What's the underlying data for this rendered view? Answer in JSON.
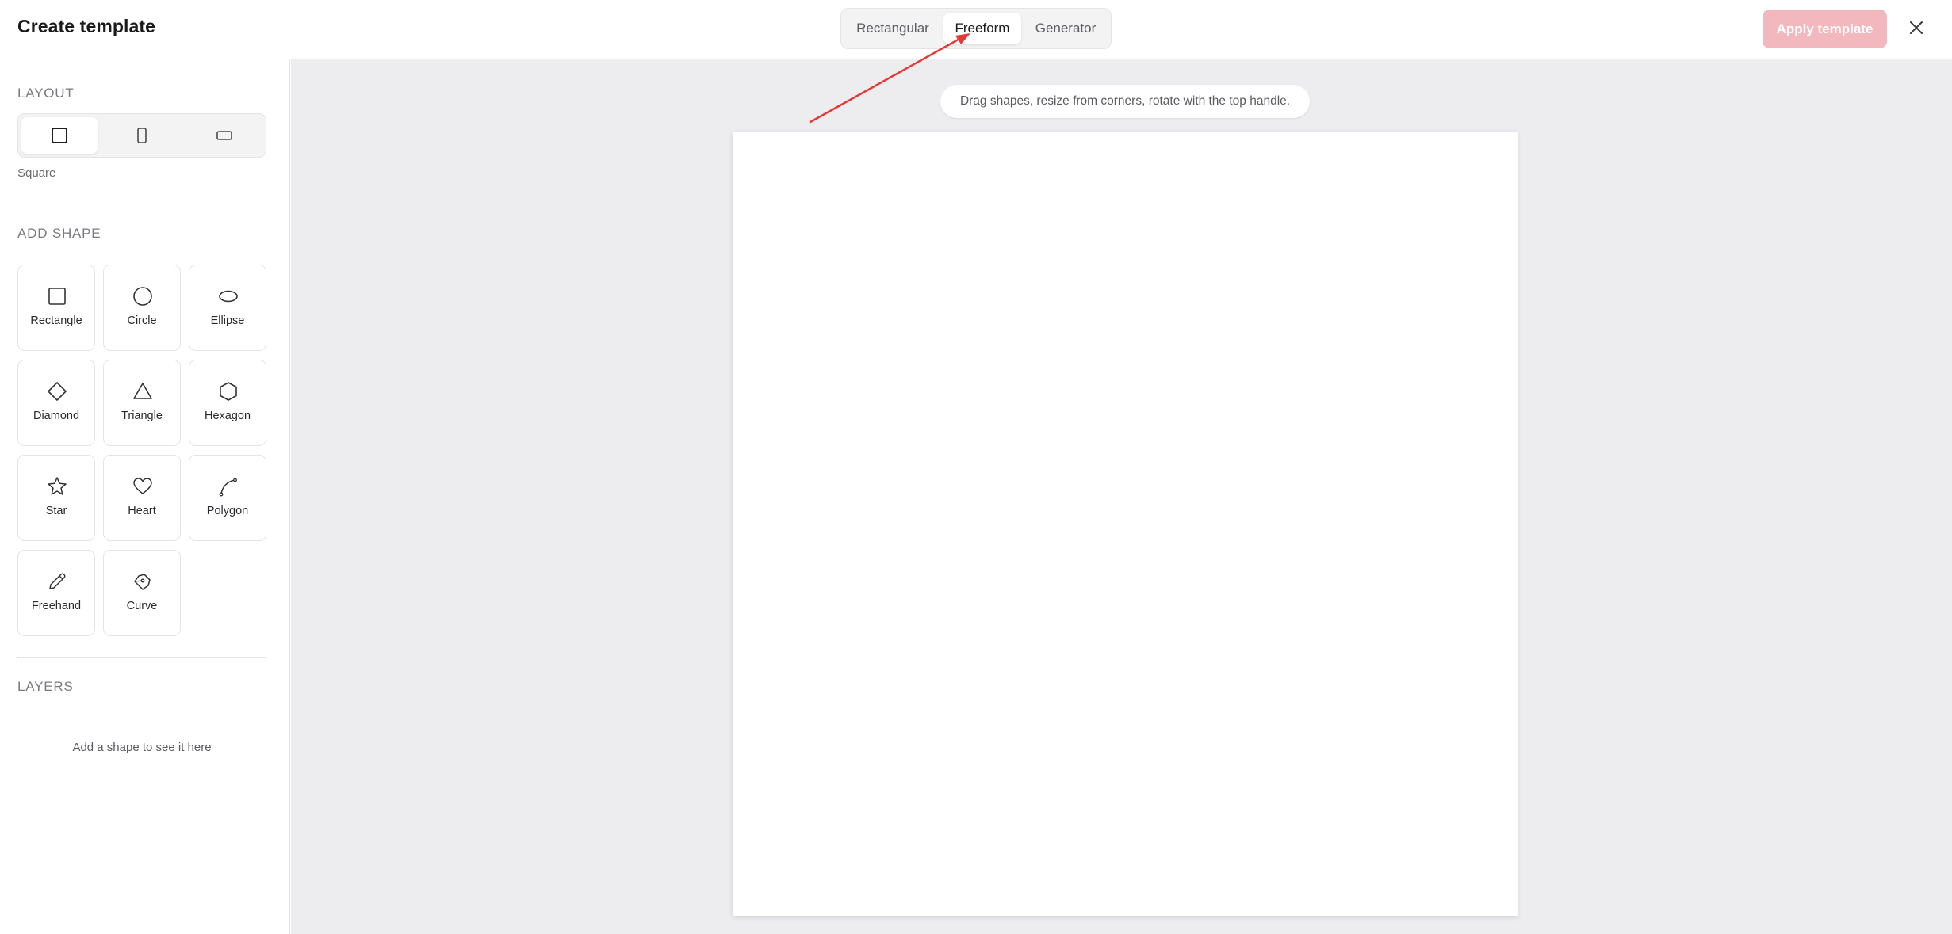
{
  "header": {
    "title": "Create template",
    "tabs": [
      {
        "label": "Rectangular",
        "active": false
      },
      {
        "label": "Freeform",
        "active": true
      },
      {
        "label": "Generator",
        "active": false
      }
    ],
    "apply_label": "Apply template",
    "apply_disabled": true
  },
  "sidebar": {
    "layout": {
      "heading": "LAYOUT",
      "options": [
        {
          "name": "square",
          "icon": "square-icon",
          "active": true
        },
        {
          "name": "portrait",
          "icon": "portrait-icon",
          "active": false
        },
        {
          "name": "landscape",
          "icon": "landscape-icon",
          "active": false
        }
      ],
      "selected_label": "Square"
    },
    "add_shape": {
      "heading": "ADD SHAPE",
      "shapes": [
        {
          "label": "Rectangle",
          "icon": "rectangle-icon"
        },
        {
          "label": "Circle",
          "icon": "circle-icon"
        },
        {
          "label": "Ellipse",
          "icon": "ellipse-icon"
        },
        {
          "label": "Diamond",
          "icon": "diamond-icon"
        },
        {
          "label": "Triangle",
          "icon": "triangle-icon"
        },
        {
          "label": "Hexagon",
          "icon": "hexagon-icon"
        },
        {
          "label": "Star",
          "icon": "star-icon"
        },
        {
          "label": "Heart",
          "icon": "heart-icon"
        },
        {
          "label": "Polygon",
          "icon": "polygon-icon"
        },
        {
          "label": "Freehand",
          "icon": "pencil-icon"
        },
        {
          "label": "Curve",
          "icon": "pen-tool-icon"
        }
      ]
    },
    "layers": {
      "heading": "LAYERS",
      "empty_text": "Add a shape to see it here"
    }
  },
  "canvas": {
    "hint": "Drag shapes, resize from corners, rotate with the top handle."
  },
  "colors": {
    "accent_disabled": "#f2b8bd",
    "annotation_arrow": "#e53935",
    "workspace_bg": "#ededf0"
  }
}
